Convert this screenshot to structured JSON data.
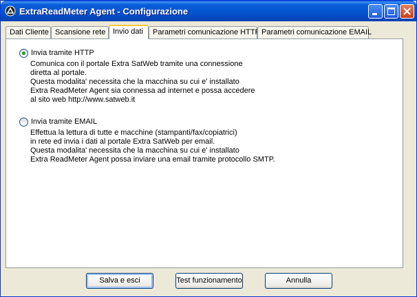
{
  "window": {
    "title": "ExtraReadMeter Agent - Configurazione"
  },
  "tabs": [
    {
      "label": "Dati Cliente"
    },
    {
      "label": "Scansione rete"
    },
    {
      "label": "Invio dati"
    },
    {
      "label": "Parametri comunicazione HTTP"
    },
    {
      "label": "Parametri comunicazione EMAIL"
    }
  ],
  "active_tab": "Invio dati",
  "options": [
    {
      "label": "Invia tramite HTTP",
      "selected": true,
      "lines": [
        "Comunica con il portale Extra SatWeb tramite una connessione",
        "diretta al portale.",
        "Questa modalita' necessita che la macchina su cui e' installato",
        "Extra ReadMeter Agent sia connessa ad internet e possa accedere",
        "al sito web http://www.satweb.it"
      ]
    },
    {
      "label": "Invia tramite EMAIL",
      "selected": false,
      "lines": [
        "Effettua la lettura di tutte e macchine (stampanti/fax/copiatrici)",
        "in rete ed invia i dati al portale Extra SatWeb per email.",
        "Questa modalita' necessita che la macchina su cui e' installato",
        "Extra ReadMeter Agent possa inviare una email tramite protocollo SMTP."
      ]
    }
  ],
  "buttons": {
    "save": "Salva e esci",
    "test": "Test funzionamento",
    "cancel": "Annulla"
  }
}
